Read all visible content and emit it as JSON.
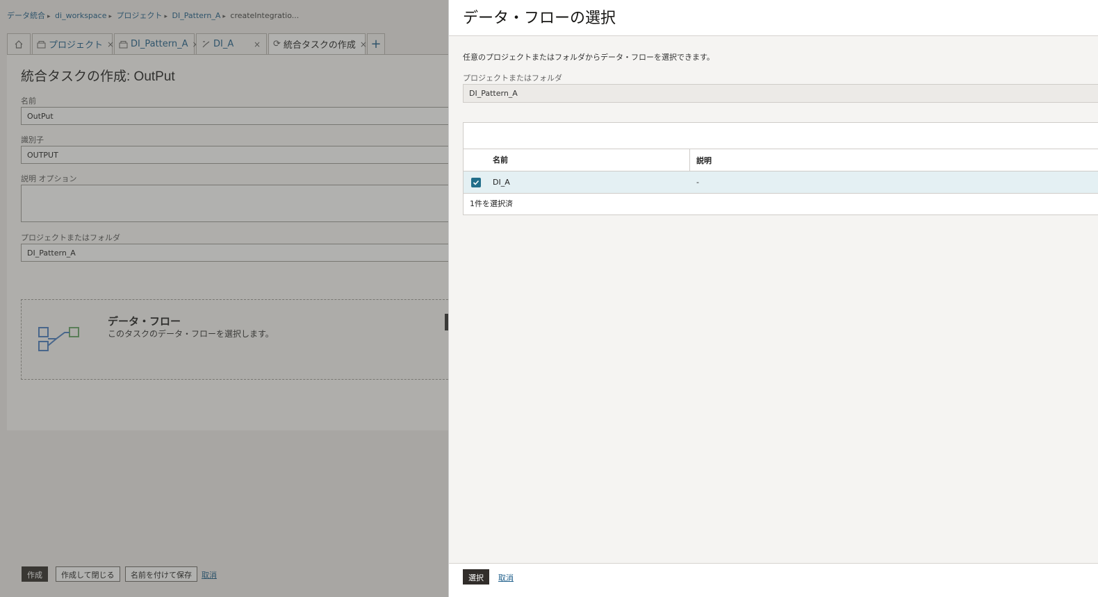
{
  "breadcrumb": {
    "items": [
      "データ統合",
      "di_workspace",
      "プロジェクト",
      "DI_Pattern_A"
    ],
    "current": "createIntegratio..."
  },
  "tabs": [
    {
      "label": "プロジェクト"
    },
    {
      "label": "DI_Pattern_A"
    },
    {
      "label": "DI_A"
    },
    {
      "label": "統合タスクの作成"
    }
  ],
  "form": {
    "title": "統合タスクの作成: OutPut",
    "name_label": "名前",
    "name_value": "OutPut",
    "identifier_label": "識別子",
    "identifier_value": "OUTPUT",
    "description_label": "説明  オプション",
    "project_label": "プロジェクトまたはフォルダ",
    "project_value": "DI_Pattern_A"
  },
  "dataflow_card": {
    "title": "データ・フロー",
    "description": "このタスクのデータ・フローを選択します。"
  },
  "footer": {
    "create": "作成",
    "create_close": "作成して閉じる",
    "save_as": "名前を付けて保存",
    "cancel": "取消"
  },
  "drawer": {
    "title": "データ・フローの選択",
    "description": "任意のプロジェクトまたはフォルダからデータ・フローを選択できます。",
    "project_label": "プロジェクトまたはフォルダ",
    "project_value": "DI_Pattern_A",
    "table": {
      "columns": [
        "名前",
        "説明"
      ],
      "rows": [
        {
          "name": "DI_A",
          "description": "-"
        }
      ],
      "selected_count": "1件を選択済"
    },
    "select_button": "選択",
    "cancel_link": "取消"
  }
}
